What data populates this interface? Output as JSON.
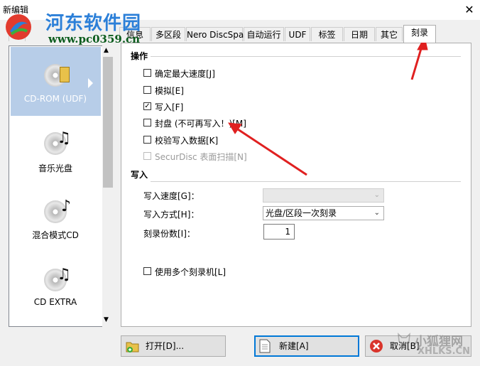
{
  "window": {
    "title": "新编辑",
    "close_glyph": "✕"
  },
  "watermark": {
    "brand": "河东软件园",
    "url": "www.pc0359.cn"
  },
  "tabs": [
    "CD",
    "信息",
    "多区段",
    "Nero DiscSpan",
    "自动运行",
    "UDF",
    "标签",
    "日期",
    "其它",
    "刻录"
  ],
  "active_tab": "刻录",
  "sidebar": {
    "items": [
      {
        "label": "CD-ROM (UDF)",
        "icon": "cd-folder-icon",
        "selected": true
      },
      {
        "label": "音乐光盘",
        "icon": "music-cd-icon"
      },
      {
        "label": "混合模式CD",
        "icon": "mixed-cd-icon"
      },
      {
        "label": "CD EXTRA",
        "icon": "cd-extra-icon"
      }
    ]
  },
  "operations": {
    "heading": "操作",
    "options": [
      {
        "label": "确定最大速度[J]",
        "checked": false,
        "disabled": false
      },
      {
        "label": "模拟[E]",
        "checked": false,
        "disabled": false
      },
      {
        "label": "写入[F]",
        "checked": true,
        "disabled": false
      },
      {
        "label": "封盘 (不可再写入！)[M]",
        "checked": false,
        "disabled": false
      },
      {
        "label": "校验写入数据[K]",
        "checked": false,
        "disabled": false
      },
      {
        "label": "SecurDisc 表面扫描[N]",
        "checked": false,
        "disabled": true
      }
    ]
  },
  "write": {
    "heading": "写入",
    "speed_label": "写入速度[G]：",
    "speed_value": "",
    "method_label": "写入方式[H]：",
    "method_value": "光盘/区段一次刻录",
    "copies_label": "刻录份数[I]：",
    "copies_value": "1",
    "multi_recorder_label": "使用多个刻录机[L]",
    "multi_recorder_checked": false
  },
  "buttons": {
    "open": "打开[D]...",
    "new": "新建[A]",
    "cancel": "取消[B]"
  },
  "corner_watermark": {
    "cn": "小狐狸网",
    "en": "XHLKS.CN"
  },
  "colors": {
    "annotation_arrow": "#e02020",
    "brand_blue": "#2b7fd8",
    "selected_item": "#cce4f7"
  }
}
